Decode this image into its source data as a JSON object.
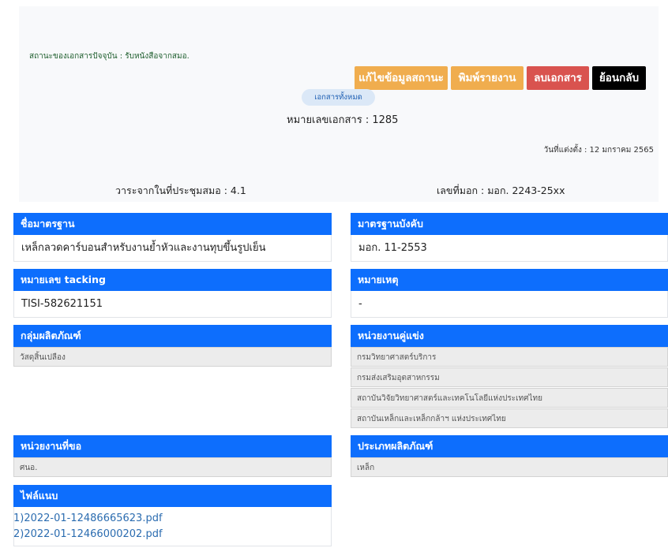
{
  "header": {
    "status_text": "สถานะของเอกสารปัจจุบัน : รับหนังสือจากสมอ.",
    "buttons": {
      "edit_status": "แก้ไขข้อมูลสถานะ",
      "print_report": "พิมพ์รายงาน",
      "delete_doc": "ลบเอกสาร",
      "back": "ย้อนกลับ"
    },
    "all_docs_pill": "เอกสารทั้งหมด",
    "doc_number": "หมายเลขเอกสาร : 1285",
    "appointed_date": "วันที่แต่งตั้ง : 12 มกราคม 2565",
    "agenda": "วาระจากในที่ประชุมสมอ : 4.1",
    "mok_number": "เลขที่มอก : มอก. 2243-25xx"
  },
  "fields": {
    "standard_name": {
      "label": "ชื่อมาตรฐาน",
      "value": "เหล็กลวดคาร์บอนสำหรับงานย้ำหัวและงานทุบขึ้นรูปเย็น"
    },
    "mandatory_standard": {
      "label": "มาตรฐานบังคับ",
      "value": "มอก. 11-2553"
    },
    "tracking_no": {
      "label": "หมายเลข tacking",
      "value": "TISI-582621151"
    },
    "remark": {
      "label": "หมายเหตุ",
      "value": "-"
    },
    "product_group": {
      "label": "กลุ่มผลิตภัณฑ์",
      "items": [
        "วัสดุสิ้นเปลือง"
      ]
    },
    "partner_agencies": {
      "label": "หน่วยงานคู่แข่ง",
      "items": [
        "กรมวิทยาศาสตร์บริการ",
        "กรมส่งเสริมอุตสาหกรรม",
        "สถาบันวิจัยวิทยาศาสตร์และเทคโนโลยีแห่งประเทศไทย",
        "สถาบันเหล็กและเหล็กกล้าฯ แห่งประเทศไทย"
      ]
    },
    "requesting_agency": {
      "label": "หน่วยงานที่ขอ",
      "items": [
        "ศนอ."
      ]
    },
    "product_type": {
      "label": "ประเภทผลิตภัณฑ์",
      "items": [
        "เหล็ก"
      ]
    },
    "attachments": {
      "label": "ไฟล์แนบ",
      "files": [
        "1)2022-01-12486665623.pdf",
        "2)2022-01-12466000202.pdf"
      ]
    }
  },
  "colors": {
    "section_header": "#0d6efd",
    "warning_button": "#f0ad4e",
    "danger_button": "#d9534f",
    "dark_button": "#000000"
  }
}
